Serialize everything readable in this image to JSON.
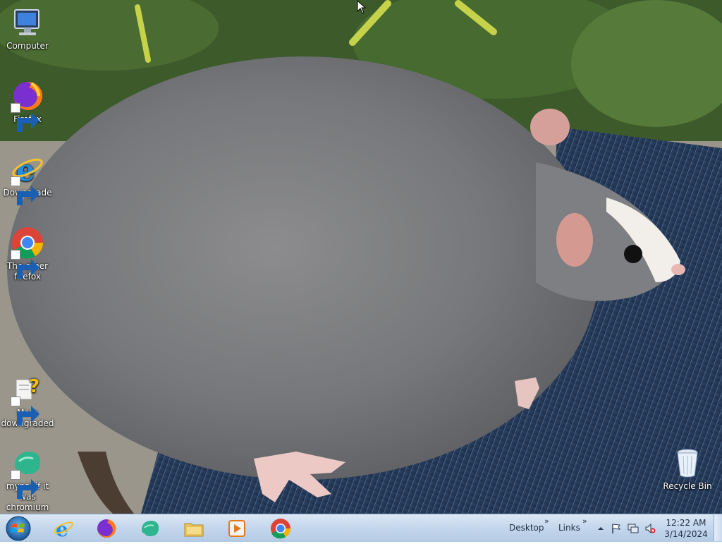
{
  "desktop": {
    "icons": [
      {
        "id": "computer",
        "label": "Computer"
      },
      {
        "id": "firefox",
        "label": "Firefox"
      },
      {
        "id": "downgrade",
        "label": "Downgrade"
      },
      {
        "id": "other-firefox",
        "label": "The other firefox"
      },
      {
        "id": "more-downgraded",
        "label": "More downgraded"
      },
      {
        "id": "mypal",
        "label": "mypal if it was chromium"
      },
      {
        "id": "recycle-bin",
        "label": "Recycle Bin"
      }
    ]
  },
  "taskbar": {
    "pinned": [
      "internet-explorer-icon",
      "firefox-icon",
      "mypal-icon",
      "file-explorer-icon",
      "media-player-icon",
      "chrome-icon"
    ],
    "toolbars": {
      "desktop": "Desktop",
      "links": "Links"
    },
    "clock": {
      "time": "12:22 AM",
      "date": "3/14/2024"
    }
  },
  "colors": {
    "taskbar": "#c3d6ec",
    "text_dark": "#1f2f44"
  }
}
